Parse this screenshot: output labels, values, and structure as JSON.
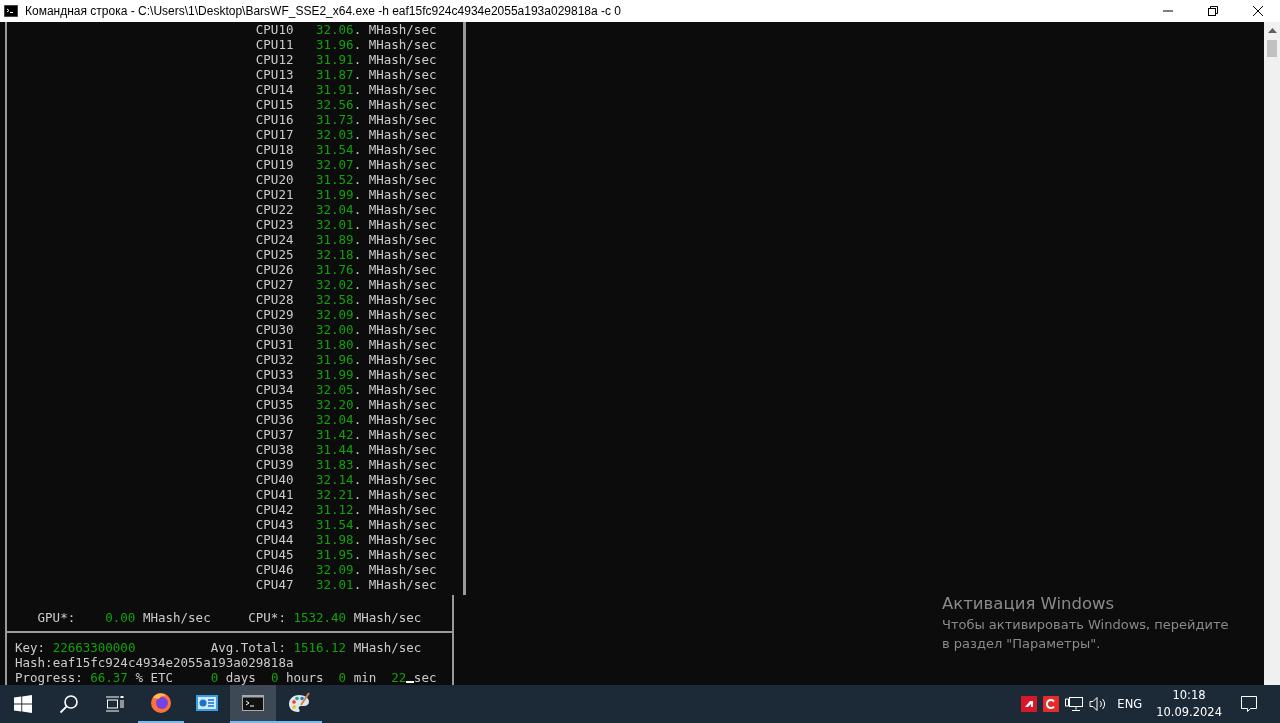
{
  "window": {
    "title": "Командная строка - C:\\Users\\1\\Desktop\\BarsWF_SSE2_x64.exe  -h eaf15fc924c4934e2055a193a029818a -c 0"
  },
  "cpu_rows": [
    {
      "label": "CPU10",
      "rate": "32.06",
      "unit": ". MHash/sec"
    },
    {
      "label": "CPU11",
      "rate": "31.96",
      "unit": ". MHash/sec"
    },
    {
      "label": "CPU12",
      "rate": "31.91",
      "unit": ". MHash/sec"
    },
    {
      "label": "CPU13",
      "rate": "31.87",
      "unit": ". MHash/sec"
    },
    {
      "label": "CPU14",
      "rate": "31.91",
      "unit": ". MHash/sec"
    },
    {
      "label": "CPU15",
      "rate": "32.56",
      "unit": ". MHash/sec"
    },
    {
      "label": "CPU16",
      "rate": "31.73",
      "unit": ". MHash/sec"
    },
    {
      "label": "CPU17",
      "rate": "32.03",
      "unit": ". MHash/sec"
    },
    {
      "label": "CPU18",
      "rate": "31.54",
      "unit": ". MHash/sec"
    },
    {
      "label": "CPU19",
      "rate": "32.07",
      "unit": ". MHash/sec"
    },
    {
      "label": "CPU20",
      "rate": "31.52",
      "unit": ". MHash/sec"
    },
    {
      "label": "CPU21",
      "rate": "31.99",
      "unit": ". MHash/sec"
    },
    {
      "label": "CPU22",
      "rate": "32.04",
      "unit": ". MHash/sec"
    },
    {
      "label": "CPU23",
      "rate": "32.01",
      "unit": ". MHash/sec"
    },
    {
      "label": "CPU24",
      "rate": "31.89",
      "unit": ". MHash/sec"
    },
    {
      "label": "CPU25",
      "rate": "32.18",
      "unit": ". MHash/sec"
    },
    {
      "label": "CPU26",
      "rate": "31.76",
      "unit": ". MHash/sec"
    },
    {
      "label": "CPU27",
      "rate": "32.02",
      "unit": ". MHash/sec"
    },
    {
      "label": "CPU28",
      "rate": "32.58",
      "unit": ". MHash/sec"
    },
    {
      "label": "CPU29",
      "rate": "32.09",
      "unit": ". MHash/sec"
    },
    {
      "label": "CPU30",
      "rate": "32.00",
      "unit": ". MHash/sec"
    },
    {
      "label": "CPU31",
      "rate": "31.80",
      "unit": ". MHash/sec"
    },
    {
      "label": "CPU32",
      "rate": "31.96",
      "unit": ". MHash/sec"
    },
    {
      "label": "CPU33",
      "rate": "31.99",
      "unit": ". MHash/sec"
    },
    {
      "label": "CPU34",
      "rate": "32.05",
      "unit": ". MHash/sec"
    },
    {
      "label": "CPU35",
      "rate": "32.20",
      "unit": ". MHash/sec"
    },
    {
      "label": "CPU36",
      "rate": "32.04",
      "unit": ". MHash/sec"
    },
    {
      "label": "CPU37",
      "rate": "31.42",
      "unit": ". MHash/sec"
    },
    {
      "label": "CPU38",
      "rate": "31.44",
      "unit": ". MHash/sec"
    },
    {
      "label": "CPU39",
      "rate": "31.83",
      "unit": ". MHash/sec"
    },
    {
      "label": "CPU40",
      "rate": "32.14",
      "unit": ". MHash/sec"
    },
    {
      "label": "CPU41",
      "rate": "32.21",
      "unit": ". MHash/sec"
    },
    {
      "label": "CPU42",
      "rate": "31.12",
      "unit": ". MHash/sec"
    },
    {
      "label": "CPU43",
      "rate": "31.54",
      "unit": ". MHash/sec"
    },
    {
      "label": "CPU44",
      "rate": "31.98",
      "unit": ". MHash/sec"
    },
    {
      "label": "CPU45",
      "rate": "31.95",
      "unit": ". MHash/sec"
    },
    {
      "label": "CPU46",
      "rate": "32.09",
      "unit": ". MHash/sec"
    },
    {
      "label": "CPU47",
      "rate": "32.01",
      "unit": ". MHash/sec"
    }
  ],
  "summary": {
    "gpu_label": "GPU*:",
    "gpu_rate": "0.00",
    "gpu_unit": "MHash/sec",
    "cpu_label": "CPU*:",
    "cpu_rate": "1532.40",
    "cpu_unit": "MHash/sec"
  },
  "status": {
    "key_label": "Key:",
    "key_value": "22663300000",
    "avg_label": "Avg.Total:",
    "avg_value": "1516.12",
    "avg_unit": "MHash/sec",
    "hash": "Hash:eaf15fc924c4934e2055a193a029818a",
    "progress_label": "Progress:",
    "progress_value": "66.37",
    "progress_unit": "% ETC",
    "days_value": "0",
    "days_unit": "days",
    "hours_value": "0",
    "hours_unit": "hours",
    "min_value": "0",
    "min_unit": "min",
    "sec_value": "22",
    "sec_unit": "sec"
  },
  "activation": {
    "title": "Активация Windows",
    "text": "Чтобы активировать Windows, перейдите в раздел \"Параметры\"."
  },
  "taskbar": {
    "apps": [
      {
        "kind": "firefox",
        "running": true,
        "active": false
      },
      {
        "kind": "control",
        "running": false,
        "active": false
      },
      {
        "kind": "terminal",
        "running": true,
        "active": true
      },
      {
        "kind": "paint",
        "running": true,
        "active": false
      }
    ],
    "language": "ENG",
    "time": "10:18",
    "date": "10.09.2024"
  }
}
